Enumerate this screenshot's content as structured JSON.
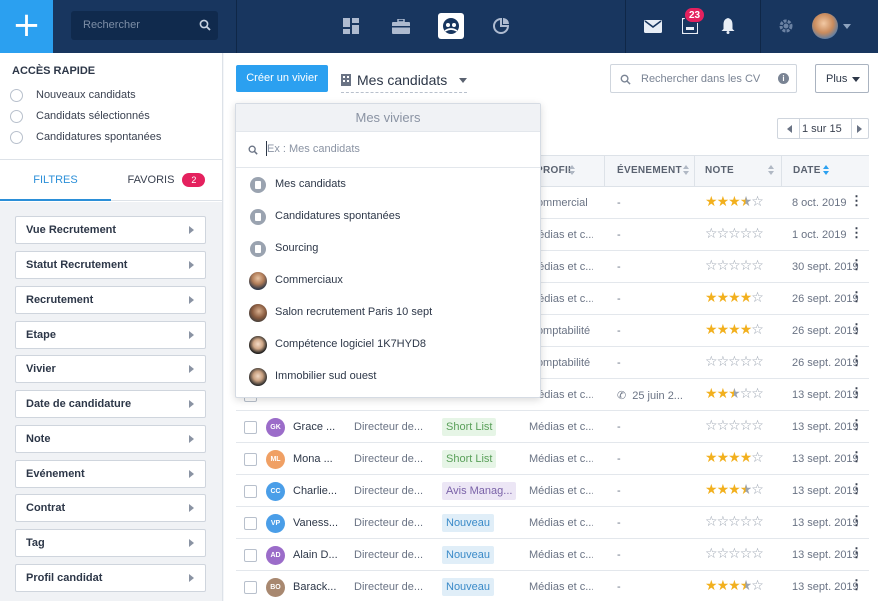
{
  "topbar": {
    "search_placeholder": "Rechercher",
    "notification_count": "23"
  },
  "sidebar": {
    "quick_access_title": "ACCÈS RAPIDE",
    "quick_access": [
      "Nouveaux candidats",
      "Candidats sélectionnés",
      "Candidatures spontanées"
    ],
    "tabs": {
      "filters": "FILTRES",
      "favorites": "FAVORIS",
      "favorites_count": "2"
    },
    "filters": [
      "Vue Recrutement",
      "Statut Recrutement",
      "Recrutement",
      "Etape",
      "Vivier",
      "Date de candidature",
      "Note",
      "Evénement",
      "Contrat",
      "Tag",
      "Profil candidat"
    ]
  },
  "toolbar": {
    "create_button": "Créer un vivier",
    "vivier_selected": "Mes candidats",
    "cv_search_placeholder": "Rechercher dans les CV",
    "more_button": "Plus",
    "pagination": "1 sur 15"
  },
  "table": {
    "headers": {
      "profil": "PROFIL",
      "evenement": "ÉVENEMENT",
      "note": "NOTE",
      "date": "DATE"
    },
    "rows": [
      {
        "initials": "",
        "name": "",
        "position": "",
        "tag": "",
        "tag_bg": "",
        "tag_fg": "",
        "profil": "Commercial",
        "event": "-",
        "rating": 3.5,
        "date": "8 oct. 2019"
      },
      {
        "initials": "",
        "name": "",
        "position": "",
        "tag": "",
        "tag_bg": "",
        "tag_fg": "",
        "profil": "Médias et c...",
        "event": "-",
        "rating": 0,
        "date": "1 oct. 2019"
      },
      {
        "initials": "",
        "name": "",
        "position": "",
        "tag": "",
        "tag_bg": "",
        "tag_fg": "",
        "profil": "Médias et c...",
        "event": "-",
        "rating": 0,
        "date": "30 sept. 2019"
      },
      {
        "initials": "",
        "name": "",
        "position": "",
        "tag": "",
        "tag_bg": "",
        "tag_fg": "",
        "profil": "Médias et c...",
        "event": "-",
        "rating": 4,
        "date": "26 sept. 2019"
      },
      {
        "initials": "",
        "name": "",
        "position": "",
        "tag": "",
        "tag_bg": "",
        "tag_fg": "",
        "profil": "Comptabilité",
        "event": "-",
        "rating": 4,
        "date": "26 sept. 2019"
      },
      {
        "initials": "",
        "name": "",
        "position": "",
        "tag": "",
        "tag_bg": "",
        "tag_fg": "",
        "profil": "Comptabilité",
        "event": "-",
        "rating": 0,
        "date": "26 sept. 2019"
      },
      {
        "initials": "",
        "name": "",
        "position": "",
        "tag": "",
        "tag_bg": "",
        "tag_fg": "",
        "profil": "Médias et c...",
        "event": "25 juin 2...",
        "rating": 2.5,
        "date": "13 sept. 2019"
      },
      {
        "initials": "GK",
        "avatar_color": "#9b6cc9",
        "name": "Grace ...",
        "position": "Directeur de...",
        "tag": "Short List",
        "tag_bg": "#e6f5e6",
        "tag_fg": "#5aa05a",
        "profil": "Médias et c...",
        "event": "-",
        "rating": 0,
        "date": "13 sept. 2019"
      },
      {
        "initials": "ML",
        "avatar_color": "#f0a064",
        "name": "Mona ...",
        "position": "Directeur de...",
        "tag": "Short List",
        "tag_bg": "#e6f5e6",
        "tag_fg": "#5aa05a",
        "profil": "Médias et c...",
        "event": "-",
        "rating": 4,
        "date": "13 sept. 2019"
      },
      {
        "initials": "CC",
        "avatar_color": "#4a9ee8",
        "name": "Charlie...",
        "position": "Directeur de...",
        "tag": "Avis Manag...",
        "tag_bg": "#ece6f5",
        "tag_fg": "#7a62a8",
        "profil": "Médias et c...",
        "event": "-",
        "rating": 3.5,
        "date": "13 sept. 2019"
      },
      {
        "initials": "VP",
        "avatar_color": "#4a9ee8",
        "name": "Vaness...",
        "position": "Directeur de...",
        "tag": "Nouveau",
        "tag_bg": "#e0eef8",
        "tag_fg": "#3a8ac8",
        "profil": "Médias et c...",
        "event": "-",
        "rating": 0,
        "date": "13 sept. 2019"
      },
      {
        "initials": "AD",
        "avatar_color": "#9b6cc9",
        "name": "Alain D...",
        "position": "Directeur de...",
        "tag": "Nouveau",
        "tag_bg": "#e0eef8",
        "tag_fg": "#3a8ac8",
        "profil": "Médias et c...",
        "event": "-",
        "rating": 0,
        "date": "13 sept. 2019"
      },
      {
        "initials": "BO",
        "avatar_color": "#a88870",
        "name": "Barack...",
        "position": "Directeur de...",
        "tag": "Nouveau",
        "tag_bg": "#e0eef8",
        "tag_fg": "#3a8ac8",
        "profil": "Médias et c...",
        "event": "-",
        "rating": 3.5,
        "date": "13 sept. 2019"
      }
    ]
  },
  "dropdown": {
    "title": "Mes viviers",
    "search_placeholder": "Ex : Mes candidats",
    "items": [
      {
        "label": "Mes candidats",
        "icon": "building-icon"
      },
      {
        "label": "Candidatures spontanées",
        "icon": "building-icon"
      },
      {
        "label": "Sourcing",
        "icon": "building-icon"
      },
      {
        "label": "Commerciaux",
        "icon": "user-photo"
      },
      {
        "label": "Salon recrutement Paris 10 sept",
        "icon": "user-photo"
      },
      {
        "label": "Compétence logiciel 1K7HYD8",
        "icon": "user-photo"
      },
      {
        "label": "Immobilier sud ouest",
        "icon": "user-photo"
      }
    ]
  },
  "colors": {
    "accent": "#2ba0f0",
    "topbar": "#18365f",
    "star": "#f2b01e",
    "badge": "#e4215e"
  }
}
